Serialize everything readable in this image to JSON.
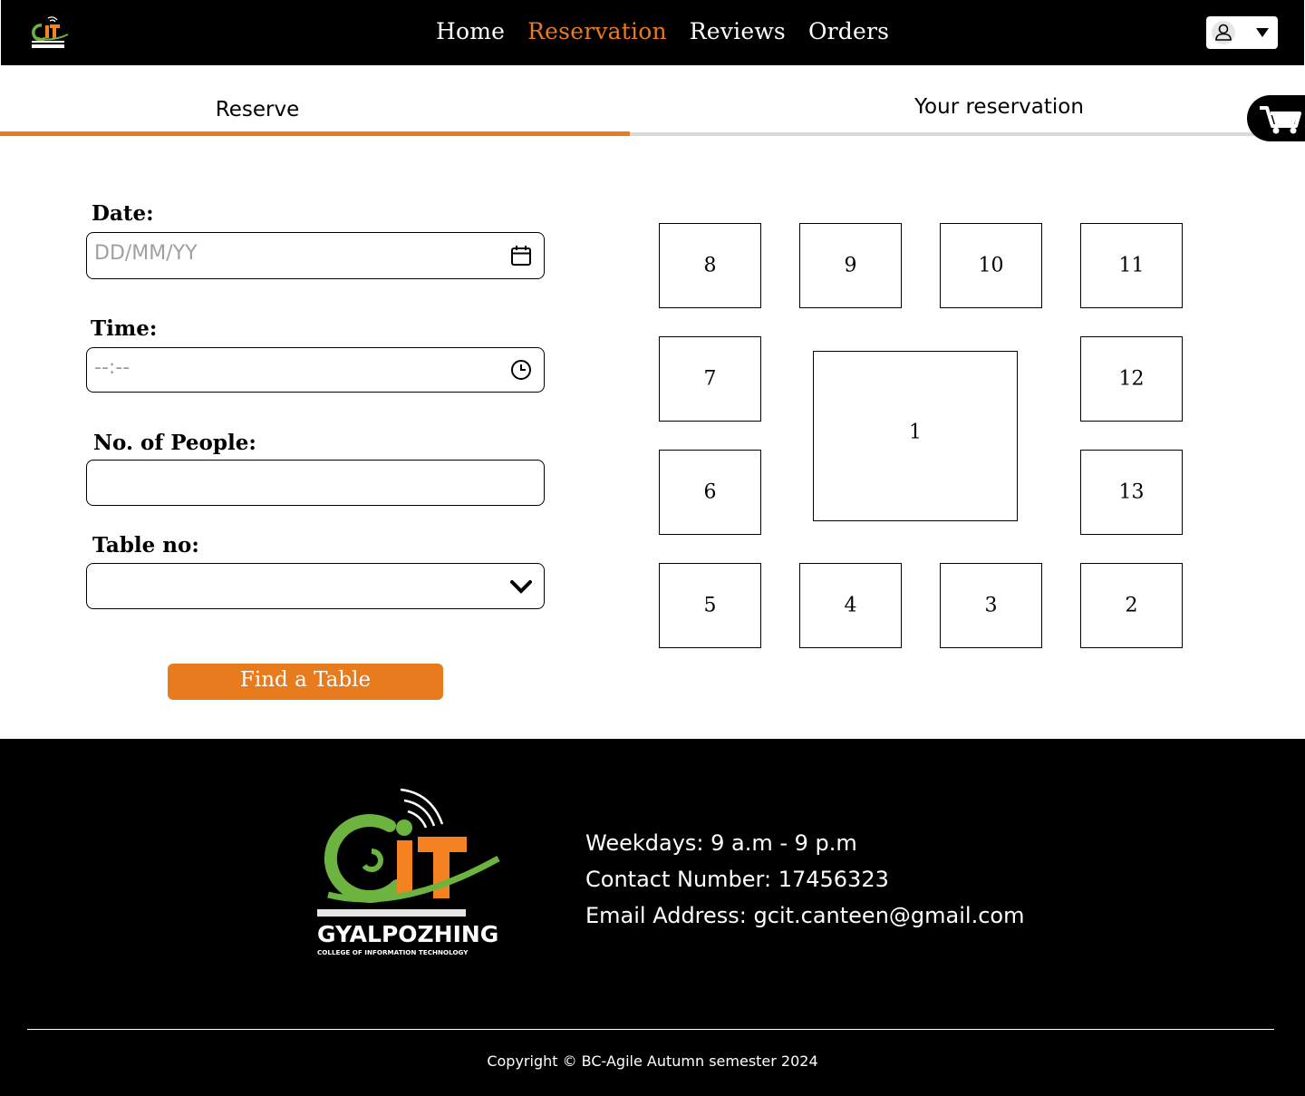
{
  "nav": {
    "logo_text": "GYALPOZHING",
    "links": [
      {
        "label": "Home"
      },
      {
        "label": "Reservation"
      },
      {
        "label": "Reviews"
      },
      {
        "label": "Orders"
      }
    ]
  },
  "tabs": {
    "reserve": "Reserve",
    "your_reservation": "Your reservation"
  },
  "form": {
    "date_label": "Date:",
    "date_placeholder": "DD/MM/YY",
    "time_label": "Time:",
    "time_placeholder": "--:--",
    "people_label": "No. of People:",
    "people_value": "",
    "table_label": "Table no:",
    "table_value": "",
    "submit_label": "Find a Table"
  },
  "tables": [
    {
      "label": "8"
    },
    {
      "label": "9"
    },
    {
      "label": "10"
    },
    {
      "label": "11"
    },
    {
      "label": "7"
    },
    {
      "label": "1"
    },
    {
      "label": "12"
    },
    {
      "label": "6"
    },
    {
      "label": "13"
    },
    {
      "label": "5"
    },
    {
      "label": "4"
    },
    {
      "label": "3"
    },
    {
      "label": "2"
    }
  ],
  "footer": {
    "logo_text": "GYALPOZHING",
    "logo_subtext": "COLLEGE OF INFORMATION TECHNOLOGY",
    "hours": "Weekdays: 9 a.m - 9 p.m",
    "contact": "Contact Number: 17456323",
    "email": "Email Address: gcit.canteen@gmail.com",
    "copyright": "Copyright © BC-Agile Autumn semester 2024"
  },
  "colors": {
    "accent": "#e87b1e",
    "logo_green": "#6db33f",
    "logo_orange": "#f58220",
    "nav_bg": "#000000"
  },
  "icons": [
    "logo-icon",
    "user-icon",
    "caret-down-icon",
    "cart-icon",
    "calendar-icon",
    "clock-icon",
    "chevron-down-icon"
  ]
}
